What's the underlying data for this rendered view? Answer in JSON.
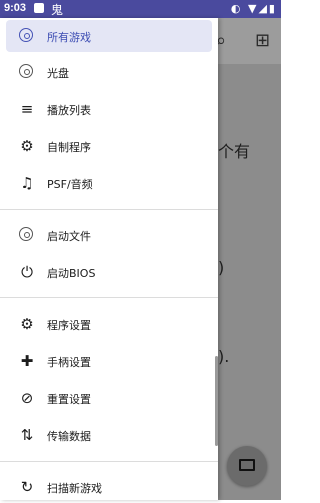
{
  "status": {
    "time": "9:03",
    "app_glyph": "鬼",
    "icons": "◐ ▼◢▮"
  },
  "background": {
    "frag1": "个有",
    "frag2": ")",
    "frag3": ")."
  },
  "drawer": {
    "items": [
      {
        "label": "所有游戏",
        "icon": "disc-icon",
        "selected": true
      },
      {
        "label": "光盘",
        "icon": "disc-icon"
      },
      {
        "label": "播放列表",
        "icon": "playlist-icon"
      },
      {
        "label": "自制程序",
        "icon": "gear-icon"
      },
      {
        "label": "PSF/音频",
        "icon": "music-library-icon"
      },
      {
        "label": "启动文件",
        "icon": "disc-icon"
      },
      {
        "label": "启动BIOS",
        "icon": "power-icon"
      },
      {
        "label": "程序设置",
        "icon": "gear-icon"
      },
      {
        "label": "手柄设置",
        "icon": "gamepad-icon"
      },
      {
        "label": "重置设置",
        "icon": "layers-clear-icon"
      },
      {
        "label": "传输数据",
        "icon": "transfer-icon"
      },
      {
        "label": "扫描新游戏",
        "icon": "refresh-icon"
      }
    ]
  },
  "colors": {
    "accent": "#4452b5",
    "selected_bg": "#e4e6f5",
    "statusbar": "#4a4a9e"
  }
}
